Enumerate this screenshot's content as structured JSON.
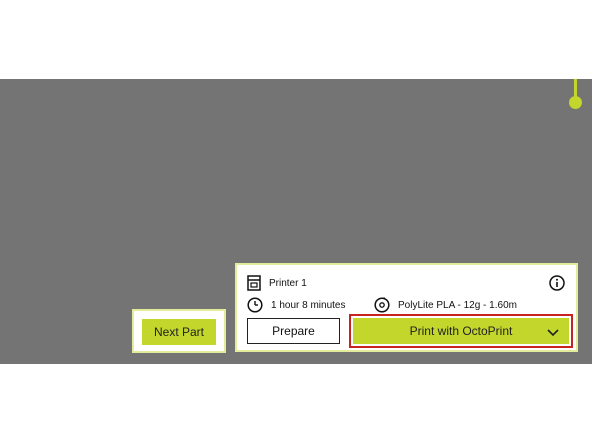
{
  "colors": {
    "viewport_bg": "#747474",
    "accent": "#c2d62b",
    "panel_border": "#e2ec9a",
    "highlight_box": "#c8231f"
  },
  "next_part": {
    "label": "Next Part"
  },
  "print_panel": {
    "printer_name": "Printer 1",
    "print_time": "1 hour 8 minutes",
    "material": "PolyLite PLA - 12g - 1.60m",
    "prepare_label": "Prepare",
    "print_label": "Print with OctoPrint"
  },
  "icons": {
    "printer": "printer-icon",
    "info": "info-icon",
    "clock": "clock-icon",
    "spool": "spool-icon",
    "dropdown": "chevron-down-icon"
  }
}
